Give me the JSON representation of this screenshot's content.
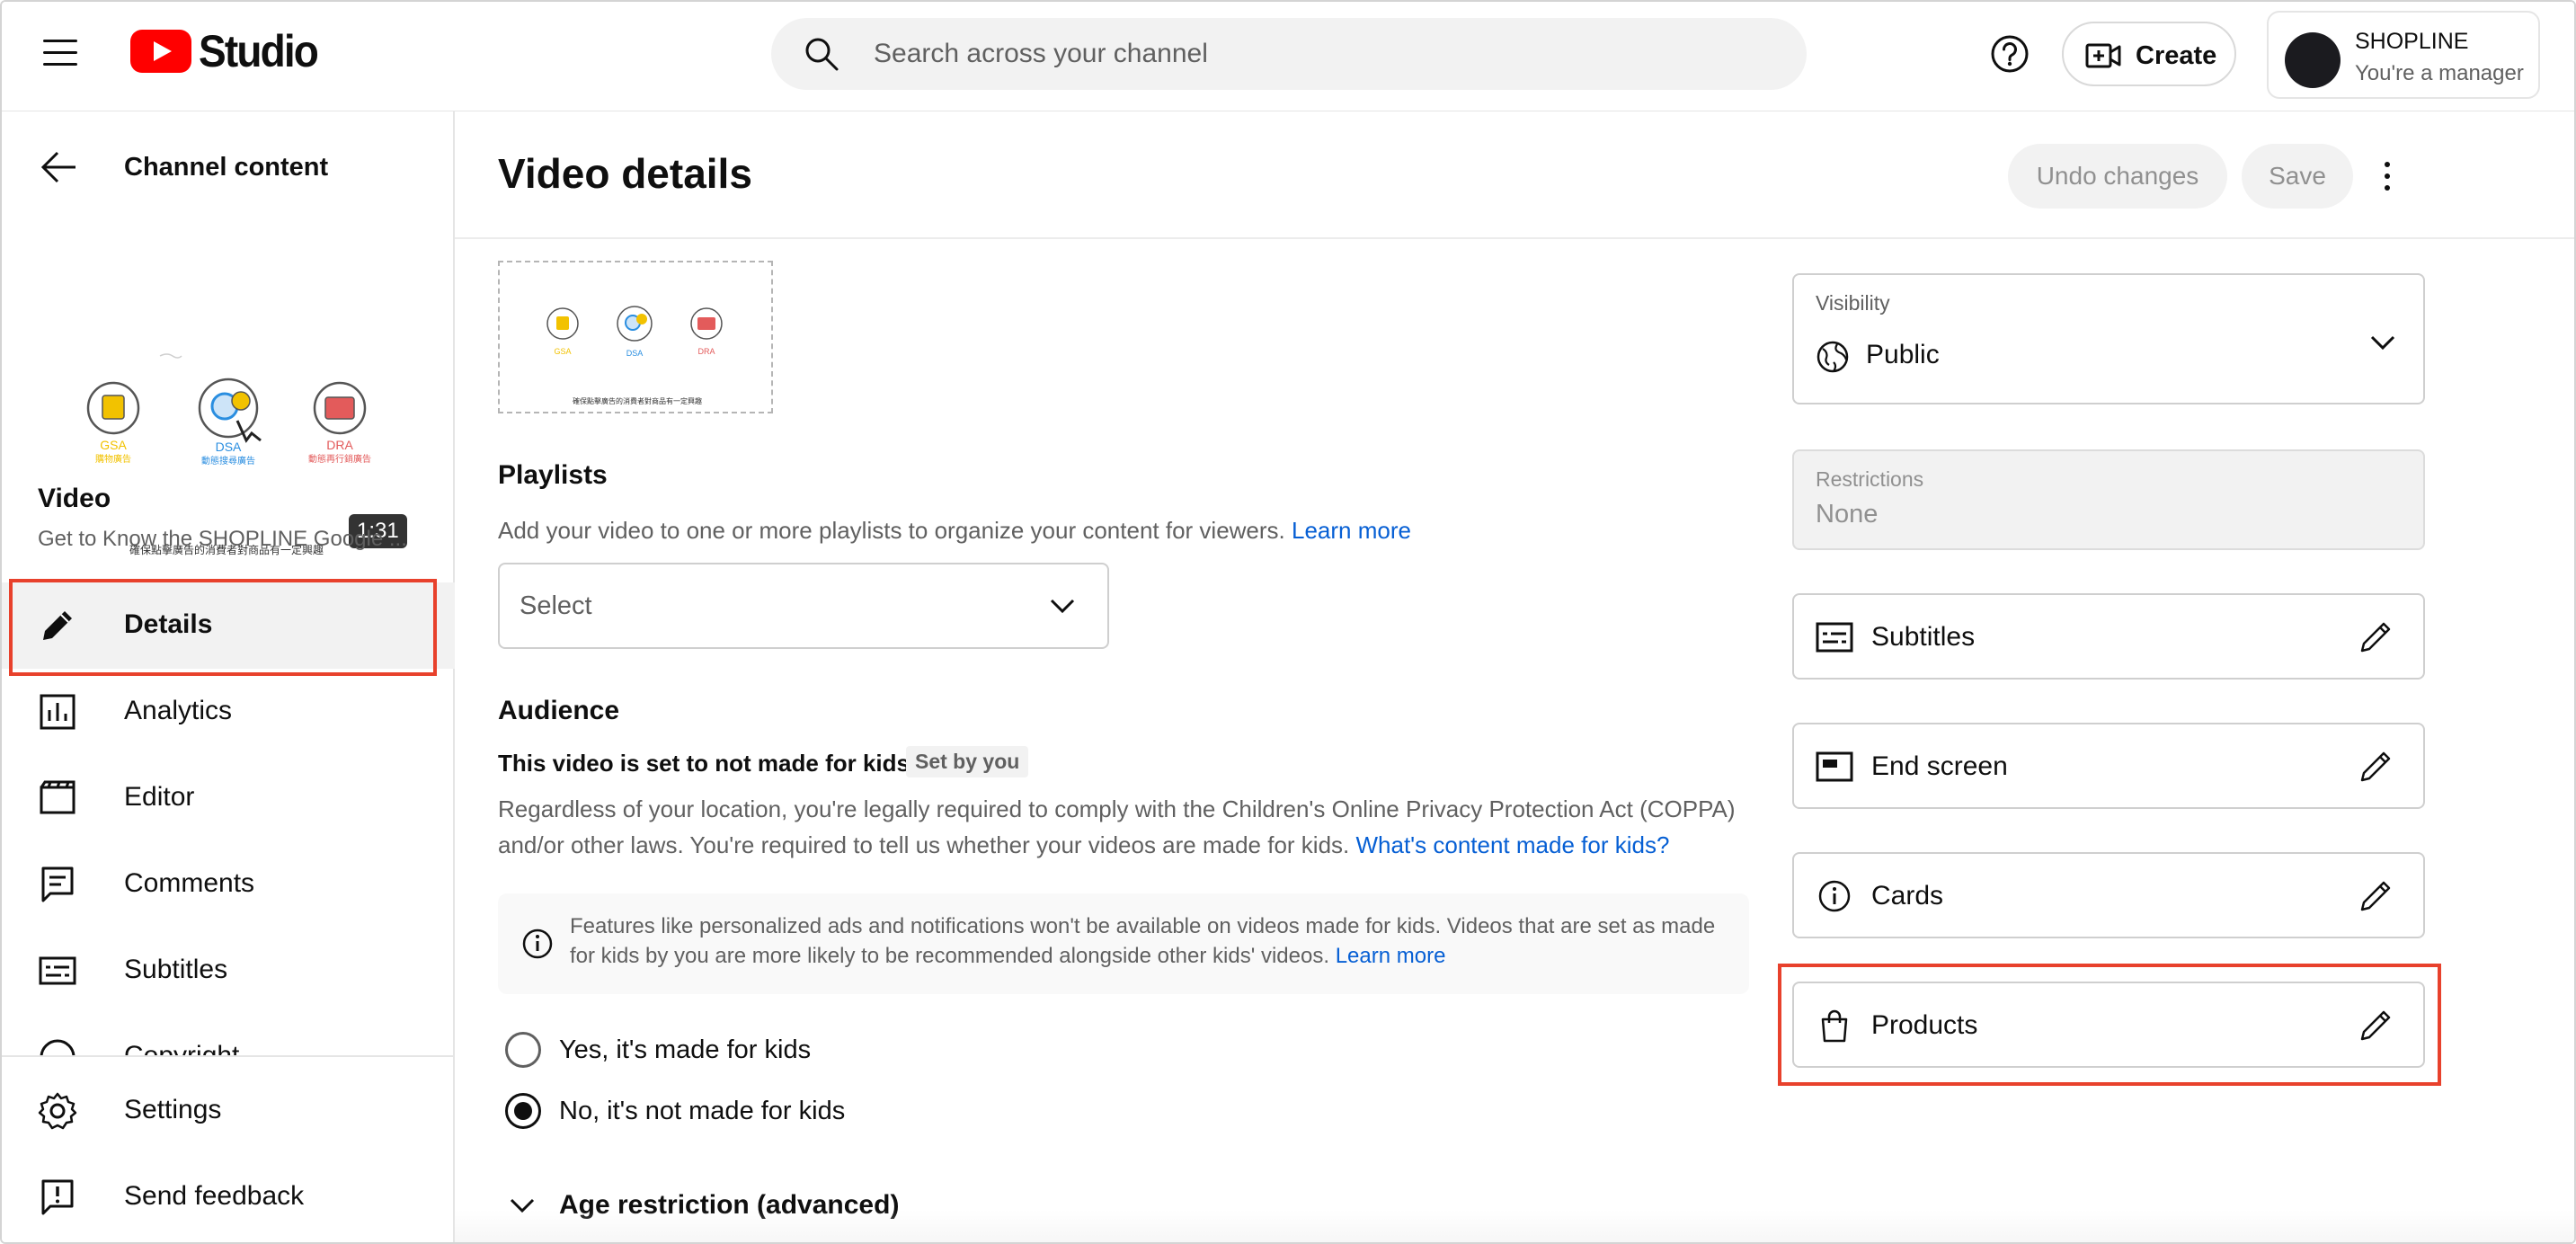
{
  "app": {
    "name": "Studio",
    "search_placeholder": "Search across your channel",
    "create_label": "Create",
    "account": {
      "name": "SHOPLINE",
      "role": "You're a manager"
    }
  },
  "sidebar": {
    "back_title": "Channel content",
    "video_label": "Video",
    "video_title": "Get to Know the SHOPLINE Google ...",
    "duration": "1:31",
    "nav": [
      {
        "label": "Details",
        "icon": "pencil-icon",
        "active": true
      },
      {
        "label": "Analytics",
        "icon": "analytics-icon",
        "active": false
      },
      {
        "label": "Editor",
        "icon": "editor-icon",
        "active": false
      },
      {
        "label": "Comments",
        "icon": "comments-icon",
        "active": false
      },
      {
        "label": "Subtitles",
        "icon": "subtitles-icon",
        "active": false
      },
      {
        "label": "Copyright",
        "icon": "copyright-icon",
        "active": false
      }
    ],
    "footer": [
      {
        "label": "Settings",
        "icon": "gear-icon"
      },
      {
        "label": "Send feedback",
        "icon": "feedback-icon"
      }
    ]
  },
  "main": {
    "title": "Video details",
    "undo_label": "Undo changes",
    "save_label": "Save",
    "playlists": {
      "heading": "Playlists",
      "text": "Add your video to one or more playlists to organize your content for viewers.",
      "link": "Learn more",
      "select_label": "Select"
    },
    "audience": {
      "heading": "Audience",
      "status": "This video is set to not made for kids",
      "badge": "Set by you",
      "text1": "Regardless of your location, you're legally required to comply with the Children's Online Privacy Protection Act (COPPA)",
      "text2": "and/or other laws. You're required to tell us whether your videos are made for kids.",
      "link": "What's content made for kids?",
      "info_text": "Features like personalized ads and notifications won't be available on videos made for kids. Videos that are set as made for kids by you are more likely to be recommended alongside other kids' videos.",
      "info_link": "Learn more",
      "option_yes": "Yes, it's made for kids",
      "option_no": "No, it's not made for kids",
      "selected": "no"
    },
    "age_restriction": "Age restriction (advanced)"
  },
  "right": {
    "visibility_label": "Visibility",
    "visibility_value": "Public",
    "restrictions_label": "Restrictions",
    "restrictions_value": "None",
    "tools": [
      {
        "label": "Subtitles",
        "icon": "subtitles-icon"
      },
      {
        "label": "End screen",
        "icon": "end-screen-icon"
      },
      {
        "label": "Cards",
        "icon": "info-icon"
      },
      {
        "label": "Products",
        "icon": "shopping-bag-icon"
      }
    ]
  },
  "thumbnail": {
    "badges": [
      "GSA",
      "DSA",
      "DRA"
    ],
    "badge_sub": [
      "購物廣告",
      "動態搜尋廣告",
      "動態再行銷廣告"
    ],
    "caption": "確保點擊廣告的消費者對商品有一定興趣",
    "colors": {
      "gsa": "#f2c200",
      "dsa": "#2a8ee0",
      "dra": "#e35b5b"
    }
  },
  "colors": {
    "accent_red": "#e8412c",
    "link": "#065fd4",
    "brand": "#ff0000"
  }
}
